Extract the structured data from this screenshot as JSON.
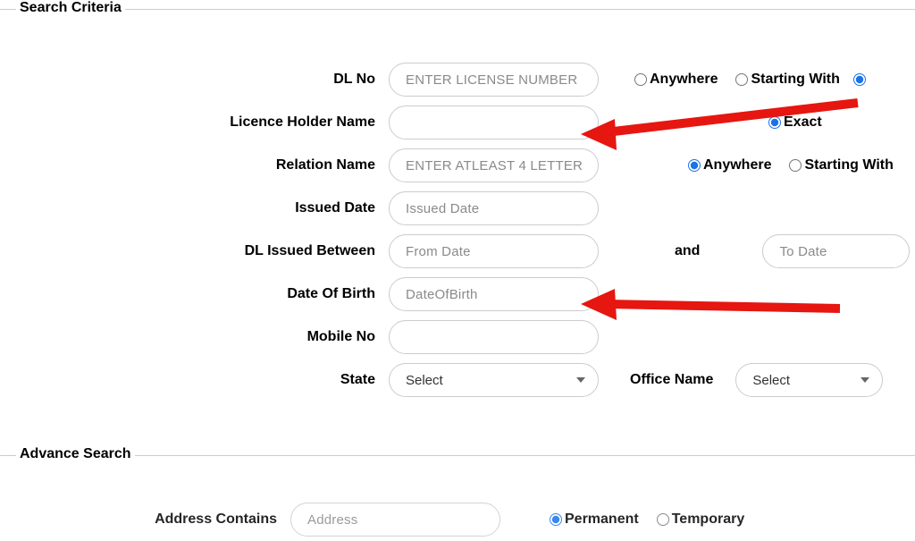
{
  "searchCriteria": {
    "legend": "Search Criteria",
    "dlNo": {
      "label": "DL No",
      "placeholder": "ENTER LICENSE NUMBER",
      "radios": [
        "Anywhere",
        "Starting With"
      ]
    },
    "holderName": {
      "label": "Licence Holder Name",
      "radios": [
        "Exact"
      ]
    },
    "relationName": {
      "label": "Relation Name",
      "placeholder": "ENTER ATLEAST 4 LETTER",
      "radios": [
        "Anywhere",
        "Starting With"
      ]
    },
    "issuedDate": {
      "label": "Issued Date",
      "placeholder": "Issued Date"
    },
    "dlBetween": {
      "label": "DL Issued Between",
      "fromPlaceholder": "From Date",
      "andText": "and",
      "toPlaceholder": "To Date"
    },
    "dob": {
      "label": "Date Of Birth",
      "placeholder": "DateOfBirth"
    },
    "mobile": {
      "label": "Mobile No"
    },
    "state": {
      "label": "State",
      "selected": "Select",
      "officeLabel": "Office Name",
      "officeSelected": "Select"
    }
  },
  "advanceSearch": {
    "legend": "Advance Search",
    "addressContains": {
      "label": "Address Contains",
      "placeholder": "Address",
      "radios": [
        "Permanent",
        "Temporary"
      ]
    }
  }
}
